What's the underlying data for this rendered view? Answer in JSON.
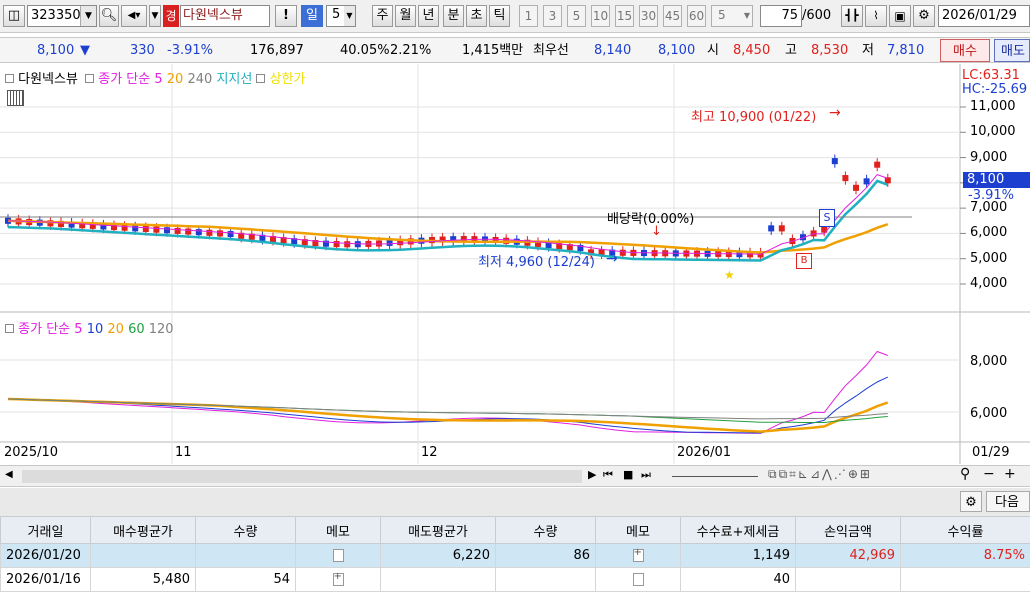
{
  "toolbar": {
    "stock_code": "323350",
    "tag": "경",
    "stock_name": "다원넥스뷰",
    "alert": "!",
    "period_selected": "일",
    "period_value": "5",
    "periods": [
      "주",
      "월",
      "년",
      "분",
      "초",
      "틱"
    ],
    "minute_options": [
      "1",
      "3",
      "5",
      "10",
      "15",
      "30",
      "45",
      "60"
    ],
    "minute_value": "5",
    "count_current": "75",
    "count_total": "/600",
    "date": "2026/01/29"
  },
  "quote": {
    "price": "8,100",
    "arrow": "▼",
    "change": "330",
    "change_pct": "-3.91%",
    "volume": "176,897",
    "vol_ratio": "40.05%",
    "turnover": "2.21%",
    "amount": "1,415백만",
    "best_label": "최우선",
    "best_ask": "8,140",
    "best_bid": "8,100",
    "open_label": "시",
    "open": "8,450",
    "high_label": "고",
    "high": "8,530",
    "low_label": "저",
    "low": "7,810",
    "buy": "매수",
    "sell": "매도"
  },
  "chart": {
    "legend_name": "다원넥스뷰",
    "legend_ma": "종가 단순",
    "legend_ma_periods": [
      "5",
      "20",
      "240"
    ],
    "legend_support": "지지선",
    "legend_upper": "상한가",
    "lc": "LC:63.31",
    "hc": "HC:-25.69",
    "price_ticks": [
      "11,000",
      "10,000",
      "9,000",
      "8,000",
      "7,000",
      "6,000",
      "5,000",
      "4,000"
    ],
    "current_price_tag": "8,100",
    "current_pct_tag": "-3.91%",
    "high_note": "최고 10,900 (01/22)",
    "low_note": "최저 4,960 (12/24)",
    "dividend_note": "배당락(0.00%)",
    "marker_s": "S",
    "marker_b": "B",
    "volume_ma_label": "종가 단순",
    "volume_ma_periods": [
      "5",
      "10",
      "20",
      "60",
      "120"
    ],
    "volume_ticks": [
      "8,000",
      "6,000"
    ],
    "date_labels": [
      "2025/10",
      "11",
      "12",
      "2026/01",
      "01/29"
    ],
    "colors": {
      "ma5": "#e020e0",
      "ma20": "#f0a000",
      "ma240": "#808080",
      "support": "#20b0c0",
      "up": "#e0211c",
      "down": "#1c3fd0"
    }
  },
  "chart_data": {
    "type": "candlestick",
    "title": "",
    "x": [
      "2025-09-29",
      "2026-01-29"
    ],
    "candles_note": "",
    "price_range": [
      3500,
      11500
    ],
    "key_values": {
      "high": 10900,
      "high_date": "01/22",
      "low": 4960,
      "low_date": "12/24",
      "last": 8100
    }
  },
  "table": {
    "headers": [
      "거래일",
      "매수평균가",
      "수량",
      "메모",
      "매도평균가",
      "수량",
      "메모",
      "수수료+제세금",
      "손익금액",
      "수익률"
    ],
    "rows": [
      [
        "2026/01/20",
        "",
        "",
        "",
        "6,220",
        "86",
        "",
        "1,149",
        "42,969",
        "8.75%"
      ],
      [
        "2026/01/16",
        "5,480",
        "54",
        "",
        "",
        "",
        "",
        "40",
        "",
        ""
      ]
    ]
  },
  "panel": {
    "next": "다음"
  }
}
